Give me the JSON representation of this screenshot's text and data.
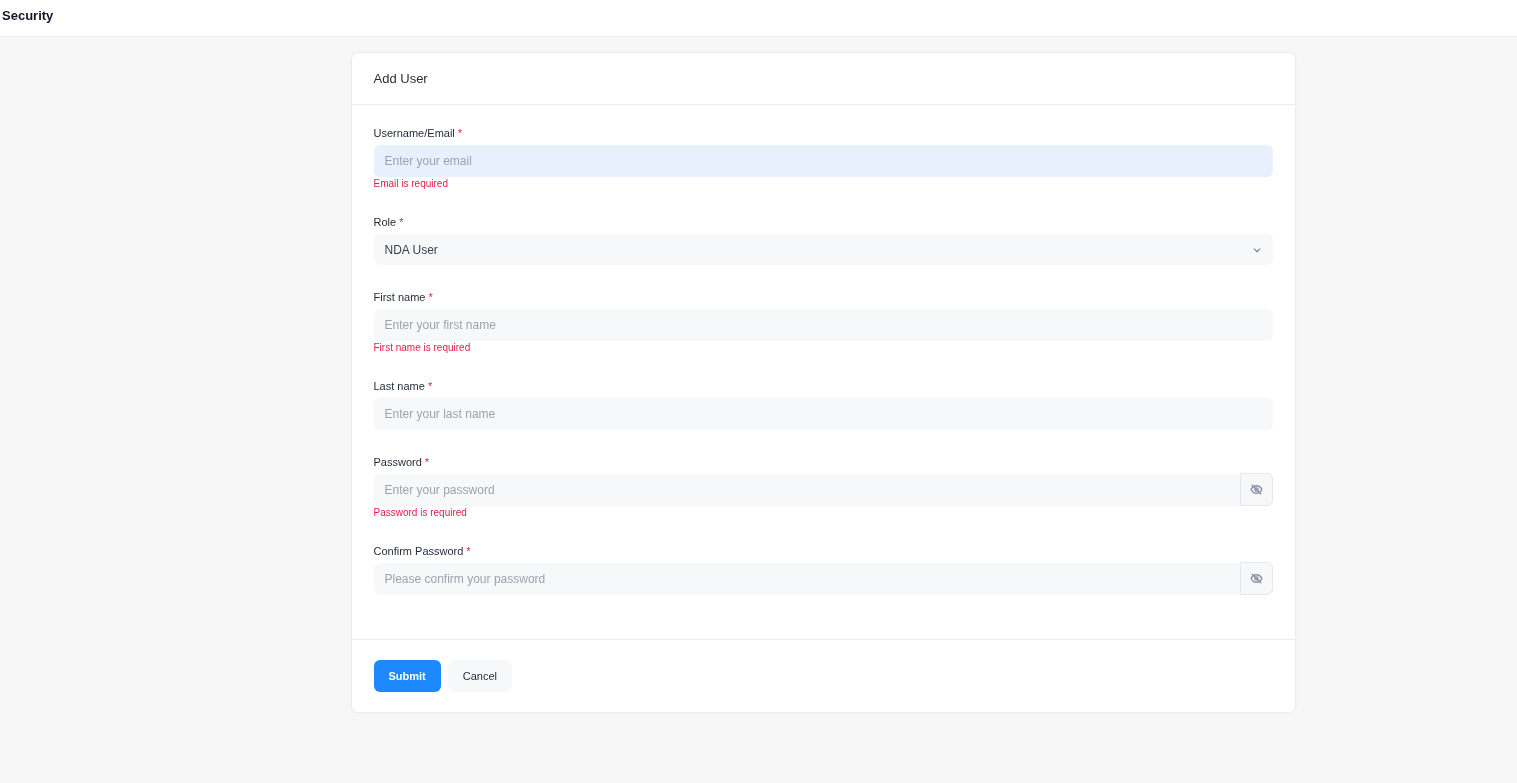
{
  "page_title": "Security",
  "card": {
    "title": "Add User",
    "fields": [
      {
        "kind": "text",
        "label": "Username/Email",
        "required_mark": "*",
        "placeholder": "Enter your email",
        "focused": true,
        "error": "Email is required"
      },
      {
        "kind": "select",
        "label": "Role",
        "required_mark": "*",
        "value": "NDA User",
        "focused": false
      },
      {
        "kind": "text",
        "label": "First name",
        "required_mark": "*",
        "placeholder": "Enter your first name",
        "focused": false,
        "error": "First name is required"
      },
      {
        "kind": "text",
        "label": "Last name",
        "required_mark": "*",
        "placeholder": "Enter your last name",
        "focused": false
      },
      {
        "kind": "password",
        "label": "Password",
        "required_mark": "*",
        "placeholder": "Enter your password",
        "focused": false,
        "error": "Password is required"
      },
      {
        "kind": "password",
        "label": "Confirm Password",
        "required_mark": "*",
        "placeholder": "Please confirm your password",
        "focused": false
      }
    ],
    "buttons": [
      {
        "kind": "primary",
        "label": "Submit"
      },
      {
        "kind": "secondary",
        "label": "Cancel"
      }
    ]
  }
}
